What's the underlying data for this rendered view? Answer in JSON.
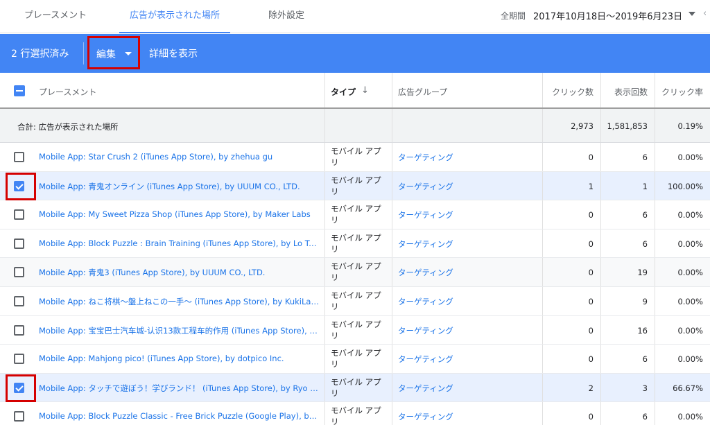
{
  "tabs": [
    {
      "label": "プレースメント"
    },
    {
      "label": "広告が表示された場所"
    },
    {
      "label": "除外設定"
    }
  ],
  "period": {
    "label": "全期間",
    "value": "2017年10月18日〜2019年6月23日"
  },
  "selection_bar": {
    "count_label": "2 行選択済み",
    "edit_label": "編集",
    "detail_label": "詳細を表示"
  },
  "table": {
    "headers": {
      "placement": "プレースメント",
      "type": "タイプ",
      "ad_group": "広告グループ",
      "clicks": "クリック数",
      "impressions": "表示回数",
      "ctr": "クリック率"
    },
    "total": {
      "label": "合計: 広告が表示された場所",
      "clicks": "2,973",
      "impressions": "1,581,853",
      "ctr": "0.19%"
    },
    "rows": [
      {
        "placement": "Mobile App: Star Crush 2 (iTunes App Store), by zhehua gu",
        "type": "モバイル アプリ",
        "ad_group": "ターゲティング",
        "clicks": "0",
        "impressions": "6",
        "ctr": "0.00%",
        "checked": false
      },
      {
        "placement": "Mobile App: 青鬼オンライン (iTunes App Store), by UUUM CO., LTD.",
        "type": "モバイル アプリ",
        "ad_group": "ターゲティング",
        "clicks": "1",
        "impressions": "1",
        "ctr": "100.00%",
        "checked": true
      },
      {
        "placement": "Mobile App: My Sweet Pizza Shop (iTunes App Store), by Maker Labs",
        "type": "モバイル アプリ",
        "ad_group": "ターゲティング",
        "clicks": "0",
        "impressions": "6",
        "ctr": "0.00%",
        "checked": false
      },
      {
        "placement": "Mobile App: Block Puzzle : Brain Training (iTunes App Store), by Lo Trung ...",
        "type": "モバイル アプリ",
        "ad_group": "ターゲティング",
        "clicks": "0",
        "impressions": "6",
        "ctr": "0.00%",
        "checked": false
      },
      {
        "placement": "Mobile App: 青鬼3 (iTunes App Store), by UUUM CO., LTD.",
        "type": "モバイル アプリ",
        "ad_group": "ターゲティング",
        "clicks": "0",
        "impressions": "19",
        "ctr": "0.00%",
        "checked": false
      },
      {
        "placement": "Mobile App: ねこ将棋〜盤上ねこの一手〜 (iTunes App Store), by KukiLabo",
        "type": "モバイル アプリ",
        "ad_group": "ターゲティング",
        "clicks": "0",
        "impressions": "9",
        "ctr": "0.00%",
        "checked": false
      },
      {
        "placement": "Mobile App: 宝宝巴士汽车城-认识13款工程车的作用 (iTunes App Store), b...",
        "type": "モバイル アプリ",
        "ad_group": "ターゲティング",
        "clicks": "0",
        "impressions": "16",
        "ctr": "0.00%",
        "checked": false
      },
      {
        "placement": "Mobile App: Mahjong pico! (iTunes App Store), by dotpico Inc.",
        "type": "モバイル アプリ",
        "ad_group": "ターゲティング",
        "clicks": "0",
        "impressions": "6",
        "ctr": "0.00%",
        "checked": false
      },
      {
        "placement": "Mobile App: タッチで遊ぼう！学びランド！ (iTunes App Store), by Ryo T...",
        "type": "モバイル アプリ",
        "ad_group": "ターゲティング",
        "clicks": "2",
        "impressions": "3",
        "ctr": "66.67%",
        "checked": true
      },
      {
        "placement": "Mobile App: Block Puzzle Classic - Free Brick Puzzle (Google Play), by Infi...",
        "type": "モバイル アプリ",
        "ad_group": "ターゲティング",
        "clicks": "0",
        "impressions": "6",
        "ctr": "0.00%",
        "checked": false
      }
    ]
  },
  "icons": {
    "sort": "arrow-down-icon",
    "period_dropdown": "caret-down-icon",
    "edit_dropdown": "caret-down-icon"
  },
  "colors": {
    "accent": "#4285f4",
    "link": "#1a73e8",
    "highlight": "#d50000",
    "selected_row": "#e8f0fe"
  }
}
